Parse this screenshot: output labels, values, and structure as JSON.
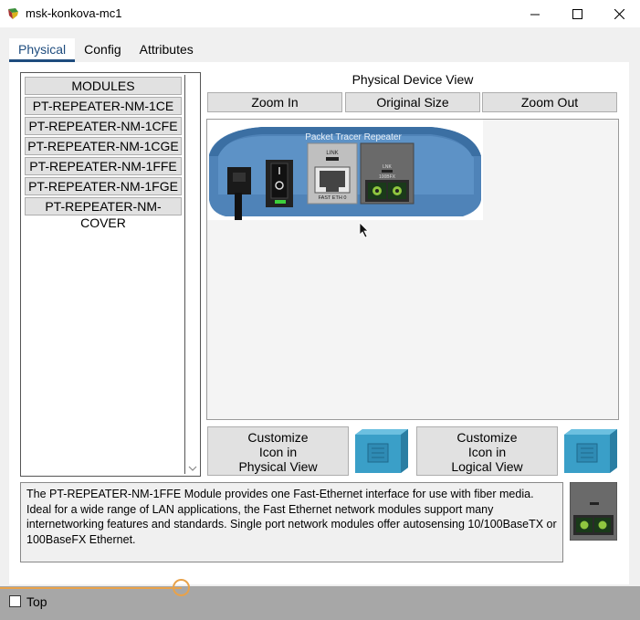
{
  "window": {
    "title": "msk-konkova-mc1",
    "minimize_icon": "minimize-icon",
    "maximize_icon": "maximize-icon",
    "close_icon": "close-icon"
  },
  "tabs": [
    {
      "label": "Physical",
      "active": true
    },
    {
      "label": "Config",
      "active": false
    },
    {
      "label": "Attributes",
      "active": false
    }
  ],
  "modules": {
    "items": [
      "MODULES",
      "PT-REPEATER-NM-1CE",
      "PT-REPEATER-NM-1CFE",
      "PT-REPEATER-NM-1CGE",
      "PT-REPEATER-NM-1FFE",
      "PT-REPEATER-NM-1FGE",
      "PT-REPEATER-NM-COVER"
    ]
  },
  "physical_view": {
    "title": "Physical Device View",
    "zoom_in": "Zoom In",
    "original_size": "Original Size",
    "zoom_out": "Zoom Out",
    "device_label": "Packet Tracer Repeater",
    "port1_label_top": "LINK",
    "port1_label_bottom": "FAST ETH 0",
    "port2_label_top": "LNK",
    "port2_label_bottom": "100BFX"
  },
  "customize": {
    "physical": [
      "Customize",
      "Icon in",
      "Physical View"
    ],
    "logical": [
      "Customize",
      "Icon in",
      "Logical View"
    ]
  },
  "description": "The PT-REPEATER-NM-1FFE Module provides one Fast-Ethernet interface for use with fiber media. Ideal for a wide range of LAN applications, the Fast Ethernet network modules support many internetworking features and standards. Single port network modules offer autosensing 10/100BaseTX or 100BaseFX Ethernet.",
  "bottom": {
    "top_checkbox_label": "Top",
    "top_checked": false
  },
  "colors": {
    "accent_tab": "#1e4c7e",
    "slider": "#e8a24a",
    "device_blue": "#4f83b8"
  }
}
